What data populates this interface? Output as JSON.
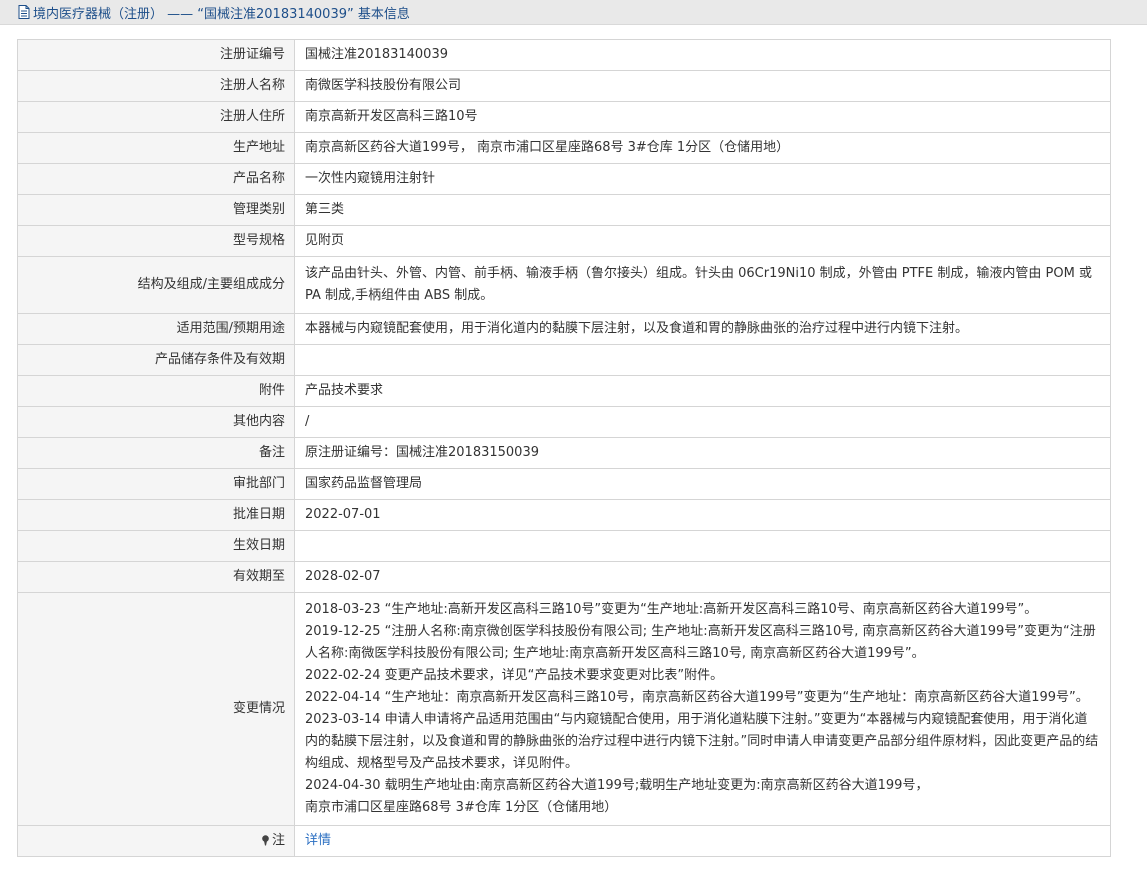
{
  "header": {
    "title": "境内医疗器械（注册） —— “国械注准20183140039” 基本信息",
    "icon": "document-icon"
  },
  "rows": [
    {
      "label": "注册证编号",
      "value": "国械注准20183140039"
    },
    {
      "label": "注册人名称",
      "value": "南微医学科技股份有限公司"
    },
    {
      "label": "注册人住所",
      "value": "南京高新开发区高科三路10号"
    },
    {
      "label": "生产地址",
      "value": "南京高新区药谷大道199号， 南京市浦口区星座路68号 3#仓库 1分区（仓储用地）"
    },
    {
      "label": "产品名称",
      "value": "一次性内窥镜用注射针"
    },
    {
      "label": "管理类别",
      "value": "第三类"
    },
    {
      "label": "型号规格",
      "value": "见附页"
    },
    {
      "label": "结构及组成/主要组成成分",
      "value": "该产品由针头、外管、内管、前手柄、输液手柄（鲁尔接头）组成。针头由 06Cr19Ni10 制成，外管由 PTFE 制成，输液内管由 POM 或 PA 制成,手柄组件由 ABS 制成。"
    },
    {
      "label": "适用范围/预期用途",
      "value": "本器械与内窥镜配套使用，用于消化道内的黏膜下层注射，以及食道和胃的静脉曲张的治疗过程中进行内镜下注射。"
    },
    {
      "label": "产品储存条件及有效期",
      "value": ""
    },
    {
      "label": "附件",
      "value": "产品技术要求"
    },
    {
      "label": "其他内容",
      "value": "/"
    },
    {
      "label": "备注",
      "value": "原注册证编号：国械注准20183150039"
    },
    {
      "label": "审批部门",
      "value": "国家药品监督管理局"
    },
    {
      "label": "批准日期",
      "value": "2022-07-01"
    },
    {
      "label": "生效日期",
      "value": ""
    },
    {
      "label": "有效期至",
      "value": "2028-02-07"
    }
  ],
  "changes": {
    "label": "变更情况",
    "lines": [
      "2018-03-23 “生产地址:高新开发区高科三路10号”变更为“生产地址:高新开发区高科三路10号、南京高新区药谷大道199号”。",
      "2019-12-25 “注册人名称:南京微创医学科技股份有限公司; 生产地址:高新开发区高科三路10号, 南京高新区药谷大道199号”变更为“注册人名称:南微医学科技股份有限公司; 生产地址:南京高新开发区高科三路10号, 南京高新区药谷大道199号”。",
      "2022-02-24 变更产品技术要求，详见“产品技术要求变更对比表”附件。",
      "2022-04-14 “生产地址：南京高新开发区高科三路10号，南京高新区药谷大道199号”变更为“生产地址：南京高新区药谷大道199号”。",
      "2023-03-14 申请人申请将产品适用范围由“与内窥镜配合使用，用于消化道粘膜下注射。”变更为“本器械与内窥镜配套使用，用于消化道内的黏膜下层注射，以及食道和胃的静脉曲张的治疗过程中进行内镜下注射。”同时申请人申请变更产品部分组件原材料，因此变更产品的结构组成、规格型号及产品技术要求，详见附件。",
      "2024-04-30 载明生产地址由:南京高新区药谷大道199号;载明生产地址变更为:南京高新区药谷大道199号，",
      "南京市浦口区星座路68号 3#仓库 1分区（仓储用地）"
    ]
  },
  "note": {
    "label": "注",
    "icon": "pin-icon",
    "link_text": "详情"
  }
}
